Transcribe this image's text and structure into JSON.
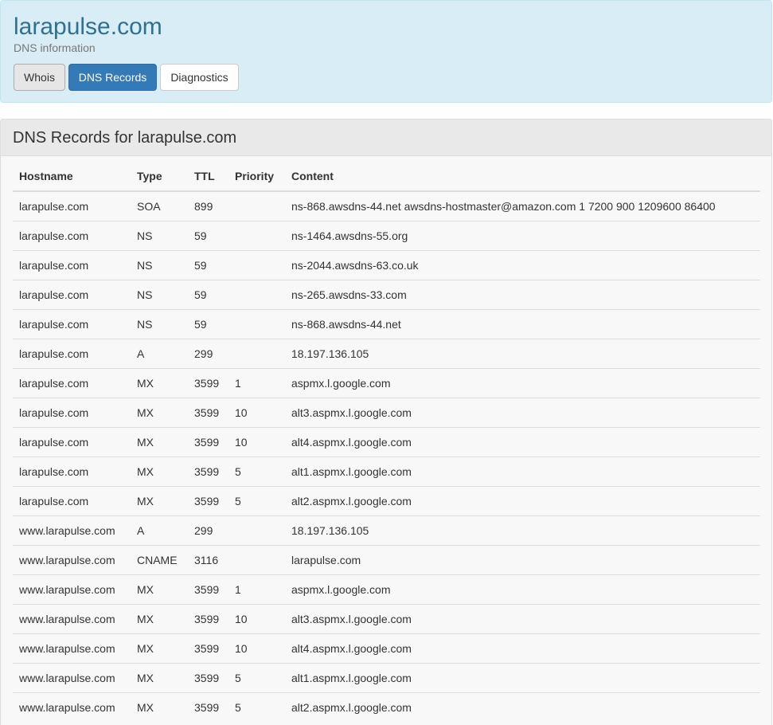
{
  "header": {
    "title": "larapulse.com",
    "subtitle": "DNS information",
    "tabs": [
      "Whois",
      "DNS Records",
      "Diagnostics"
    ],
    "active_tab": "DNS Records"
  },
  "records": {
    "title": "DNS Records for larapulse.com",
    "columns": [
      "Hostname",
      "Type",
      "TTL",
      "Priority",
      "Content"
    ],
    "rows": [
      [
        "larapulse.com",
        "SOA",
        "899",
        "",
        "ns-868.awsdns-44.net awsdns-hostmaster@amazon.com 1 7200 900 1209600 86400"
      ],
      [
        "larapulse.com",
        "NS",
        "59",
        "",
        "ns-1464.awsdns-55.org"
      ],
      [
        "larapulse.com",
        "NS",
        "59",
        "",
        "ns-2044.awsdns-63.co.uk"
      ],
      [
        "larapulse.com",
        "NS",
        "59",
        "",
        "ns-265.awsdns-33.com"
      ],
      [
        "larapulse.com",
        "NS",
        "59",
        "",
        "ns-868.awsdns-44.net"
      ],
      [
        "larapulse.com",
        "A",
        "299",
        "",
        "18.197.136.105"
      ],
      [
        "larapulse.com",
        "MX",
        "3599",
        "1",
        "aspmx.l.google.com"
      ],
      [
        "larapulse.com",
        "MX",
        "3599",
        "10",
        "alt3.aspmx.l.google.com"
      ],
      [
        "larapulse.com",
        "MX",
        "3599",
        "10",
        "alt4.aspmx.l.google.com"
      ],
      [
        "larapulse.com",
        "MX",
        "3599",
        "5",
        "alt1.aspmx.l.google.com"
      ],
      [
        "larapulse.com",
        "MX",
        "3599",
        "5",
        "alt2.aspmx.l.google.com"
      ],
      [
        "www.larapulse.com",
        "A",
        "299",
        "",
        "18.197.136.105"
      ],
      [
        "www.larapulse.com",
        "CNAME",
        "3116",
        "",
        "larapulse.com"
      ],
      [
        "www.larapulse.com",
        "MX",
        "3599",
        "1",
        "aspmx.l.google.com"
      ],
      [
        "www.larapulse.com",
        "MX",
        "3599",
        "10",
        "alt3.aspmx.l.google.com"
      ],
      [
        "www.larapulse.com",
        "MX",
        "3599",
        "10",
        "alt4.aspmx.l.google.com"
      ],
      [
        "www.larapulse.com",
        "MX",
        "3599",
        "5",
        "alt1.aspmx.l.google.com"
      ],
      [
        "www.larapulse.com",
        "MX",
        "3599",
        "5",
        "alt2.aspmx.l.google.com"
      ]
    ]
  },
  "colors": {
    "header_bg": "#d9edf7",
    "title": "#31708f",
    "active_tab_bg": "#337ab7"
  }
}
